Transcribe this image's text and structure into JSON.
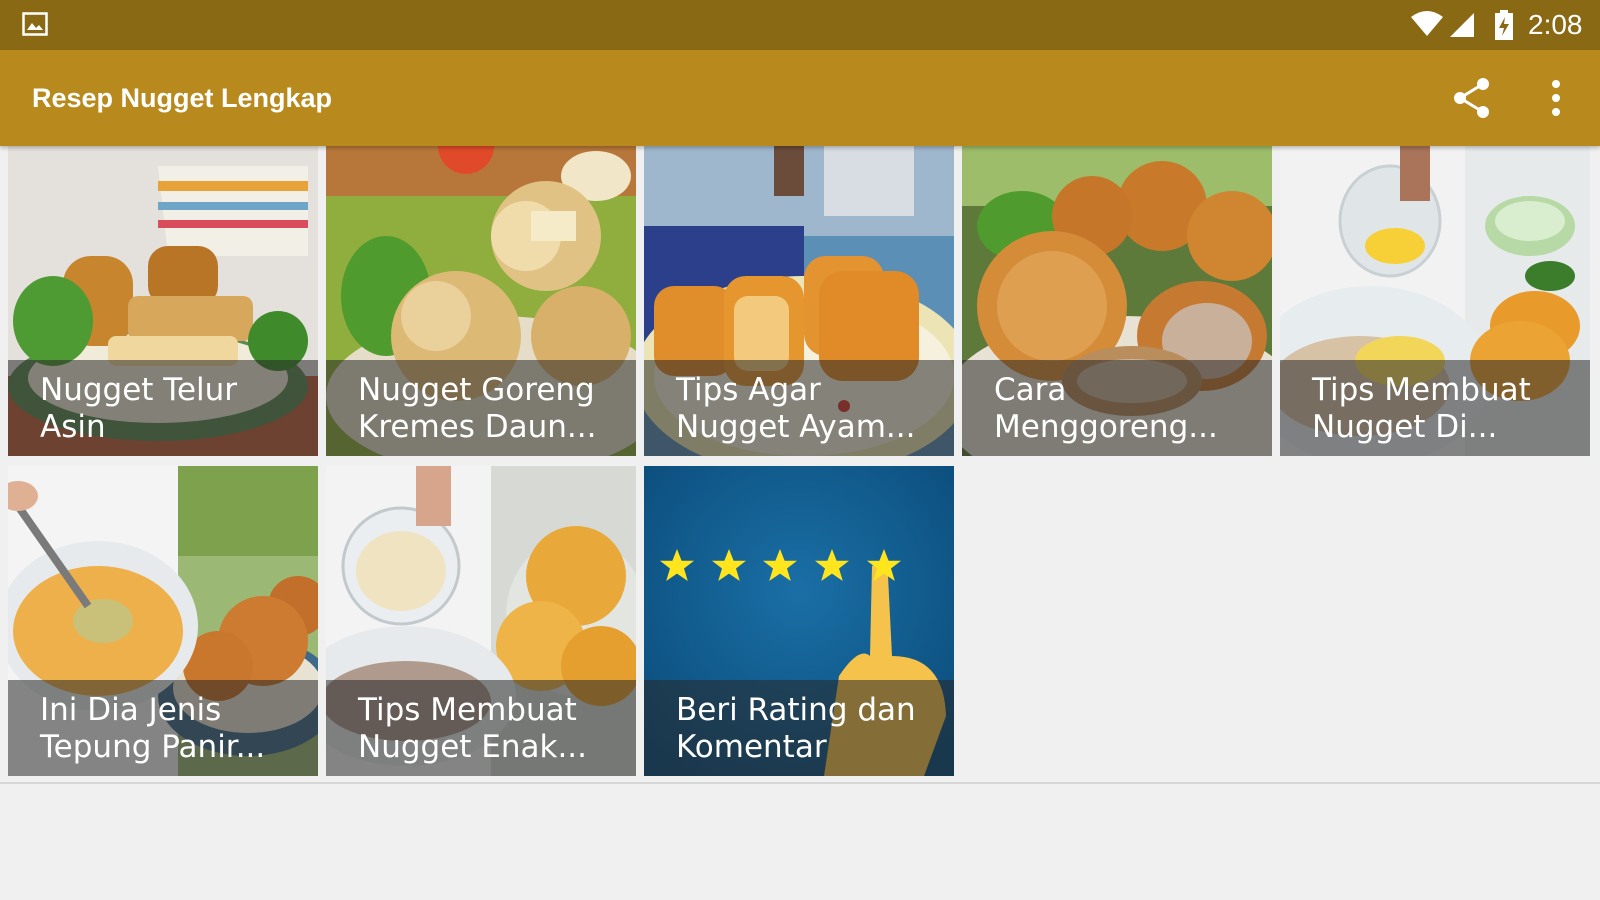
{
  "status_bar": {
    "time": "2:08",
    "icons": [
      "gallery-icon",
      "wifi-icon",
      "signal-icon",
      "battery-charging-icon"
    ]
  },
  "app_bar": {
    "title": "Resep Nugget Lengkap",
    "actions": [
      "share-icon",
      "more-vert-icon"
    ]
  },
  "tiles": [
    {
      "title": "Nugget Telur\nAsin"
    },
    {
      "title": "Nugget Goreng\nKremes Daun..."
    },
    {
      "title": "Tips Agar\nNugget Ayam..."
    },
    {
      "title": "Cara\nMenggoreng..."
    },
    {
      "title": "Tips Membuat\nNugget Di..."
    },
    {
      "title": "Ini Dia Jenis\nTepung Panir..."
    },
    {
      "title": "Tips Membuat\nNugget Enak..."
    },
    {
      "title": "Beri Rating dan\nKomentar"
    }
  ],
  "colors": {
    "status_bar": "#8a6914",
    "app_bar": "#b8891c",
    "rating_bg": "#0f5a8c",
    "star": "#ffe51e"
  }
}
